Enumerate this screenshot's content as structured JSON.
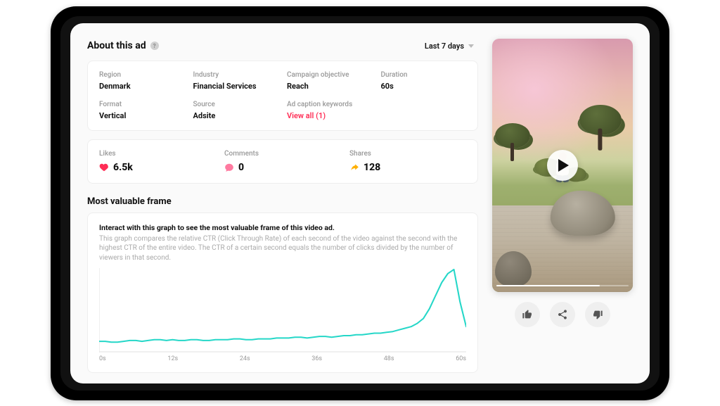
{
  "header": {
    "title": "About this ad",
    "range_label": "Last 7 days"
  },
  "meta": {
    "region_label": "Region",
    "region_value": "Denmark",
    "industry_label": "Industry",
    "industry_value": "Financial Services",
    "objective_label": "Campaign objective",
    "objective_value": "Reach",
    "duration_label": "Duration",
    "duration_value": "60s",
    "format_label": "Format",
    "format_value": "Vertical",
    "source_label": "Source",
    "source_value": "Adsite",
    "keywords_label": "Ad caption keywords",
    "keywords_link": "View all (1)"
  },
  "engagement": {
    "likes_label": "Likes",
    "likes_value": "6.5k",
    "comments_label": "Comments",
    "comments_value": "0",
    "shares_label": "Shares",
    "shares_value": "128"
  },
  "mvf": {
    "section_title": "Most valuable frame",
    "instruction_bold": "Interact with this graph to see the most valuable frame of this video ad.",
    "instruction_sub": "This graph compares the relative CTR (Click Through Rate) of each second of the video against the second with the highest CTR of the entire video. The CTR of a certain second equals the number of clicks divided by the number of viewers in that second."
  },
  "chart_data": {
    "type": "line",
    "xlabel": "",
    "ylabel": "",
    "x_ticks": [
      "0s",
      "12s",
      "24s",
      "36s",
      "48s",
      "60s"
    ],
    "x": [
      0,
      1,
      2,
      3,
      4,
      5,
      6,
      7,
      8,
      9,
      10,
      11,
      12,
      13,
      14,
      15,
      16,
      17,
      18,
      19,
      20,
      21,
      22,
      23,
      24,
      25,
      26,
      27,
      28,
      29,
      30,
      31,
      32,
      33,
      34,
      35,
      36,
      37,
      38,
      39,
      40,
      41,
      42,
      43,
      44,
      45,
      46,
      47,
      48,
      49,
      50,
      51,
      52,
      53,
      54,
      55,
      56,
      57,
      58,
      59,
      60
    ],
    "values": [
      12,
      12,
      11,
      11,
      12,
      13,
      13,
      12,
      13,
      14,
      14,
      13,
      14,
      13,
      13,
      14,
      14,
      13,
      13,
      14,
      14,
      14,
      15,
      15,
      14,
      14,
      15,
      15,
      15,
      16,
      16,
      16,
      17,
      17,
      16,
      17,
      18,
      18,
      17,
      18,
      19,
      19,
      20,
      20,
      21,
      22,
      22,
      23,
      24,
      26,
      28,
      30,
      34,
      40,
      52,
      68,
      84,
      95,
      100,
      60,
      30
    ],
    "ylim": [
      0,
      100
    ]
  },
  "icons": {
    "like": "heart-icon",
    "comment": "comment-icon",
    "share": "share-arrow-icon",
    "thumbs_up": "thumbs-up-icon",
    "share_node": "share-node-icon",
    "thumbs_down": "thumbs-down-icon",
    "play": "play-icon",
    "info": "info-icon",
    "chevron": "chevron-down-icon"
  },
  "colors": {
    "accent_pink": "#ff2d55",
    "accent_orange": "#ffb000",
    "chart_line": "#25d7c8"
  }
}
